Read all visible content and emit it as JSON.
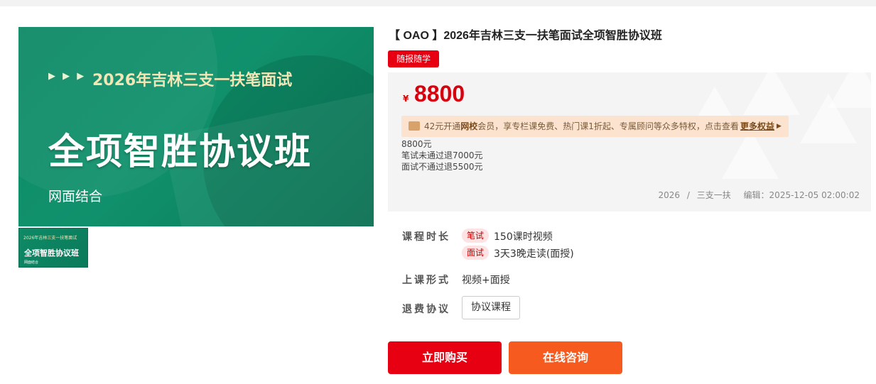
{
  "banner": {
    "arrows": "▶ ▶ ▶",
    "subtitle": "2026年吉林三支一扶笔面试",
    "title": "全项智胜协议班",
    "footer": "网面结合"
  },
  "thumbnail": {
    "subtitle": "2026年吉林三支一扶笔面试",
    "title": "全项智胜协议班",
    "footer": "网面结合"
  },
  "product": {
    "title": "【 OAO 】2026年吉林三支一扶笔面试全项智胜协议班",
    "tag": "随报随学"
  },
  "price": {
    "currency": "¥",
    "amount": "8800",
    "vip_text_1": "42元开通",
    "vip_text_strong": "网校",
    "vip_text_2": "会员，享专栏课免费、热门课1折起、专属顾问等众多特权，点击查看",
    "vip_more": "更多权益",
    "vip_arrow": "▶",
    "lines": [
      "8800元",
      "笔试未通过退7000元",
      "面试不通过退5500元"
    ],
    "meta_year": "2026",
    "meta_sep": "/",
    "meta_category": "三支一扶",
    "meta_edit": "编辑：2025-12-05 02:00:02"
  },
  "details": {
    "duration_label": "课程时长",
    "written_chip": "笔试",
    "written_value": "150课时视频",
    "interview_chip": "面试",
    "interview_value": "3天3晚走读(面授)",
    "format_label": "上课形式",
    "format_value": "视频+面授",
    "refund_label": "退费协议",
    "refund_button": "协议课程"
  },
  "actions": {
    "buy": "立即购买",
    "consult": "在线咨询"
  },
  "colors": {
    "accent_red": "#e60012",
    "consult_orange": "#f65a1e",
    "banner_green": "#0e8a66",
    "price_red": "#d7000f"
  }
}
